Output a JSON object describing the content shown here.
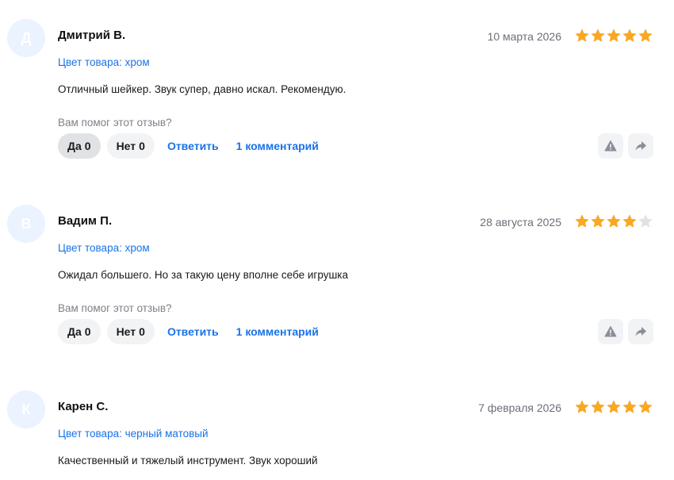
{
  "colors": {
    "accent": "#1a73e8",
    "star_filled": "#f9a825",
    "star_empty": "#e0e2e6",
    "avatar_bg": "#eaf3ff",
    "button_bg": "#f2f3f5",
    "muted_text": "#7d8189"
  },
  "reviews": [
    {
      "avatar_letter": "Д",
      "author": "Дмитрий В.",
      "date": "10 марта 2026",
      "rating": 5,
      "variant": "Цвет товара: хром",
      "text": "Отличный шейкер. Звук супер, давно искал. Рекомендую.",
      "helpful_question": "Вам помог этот отзыв?",
      "yes_label": "Да",
      "yes_count": "0",
      "no_label": "Нет",
      "no_count": "0",
      "reply_label": "Ответить",
      "comments_label": "1 комментарий",
      "report_icon": "warning-icon",
      "share_icon": "share-arrow-icon"
    },
    {
      "avatar_letter": "В",
      "author": "Вадим П.",
      "date": "28 августа 2025",
      "rating": 4,
      "variant": "Цвет товара: хром",
      "text": "Ожидал большего. Но за такую цену вполне себе игрушка",
      "helpful_question": "Вам помог этот отзыв?",
      "yes_label": "Да",
      "yes_count": "0",
      "no_label": "Нет",
      "no_count": "0",
      "reply_label": "Ответить",
      "comments_label": "1 комментарий",
      "report_icon": "warning-icon",
      "share_icon": "share-arrow-icon"
    },
    {
      "avatar_letter": "К",
      "author": "Карен С.",
      "date": "7 февраля 2026",
      "rating": 5,
      "variant": "Цвет товара: черный матовый",
      "text": "Качественный и тяжелый инструмент. Звук хороший"
    }
  ]
}
